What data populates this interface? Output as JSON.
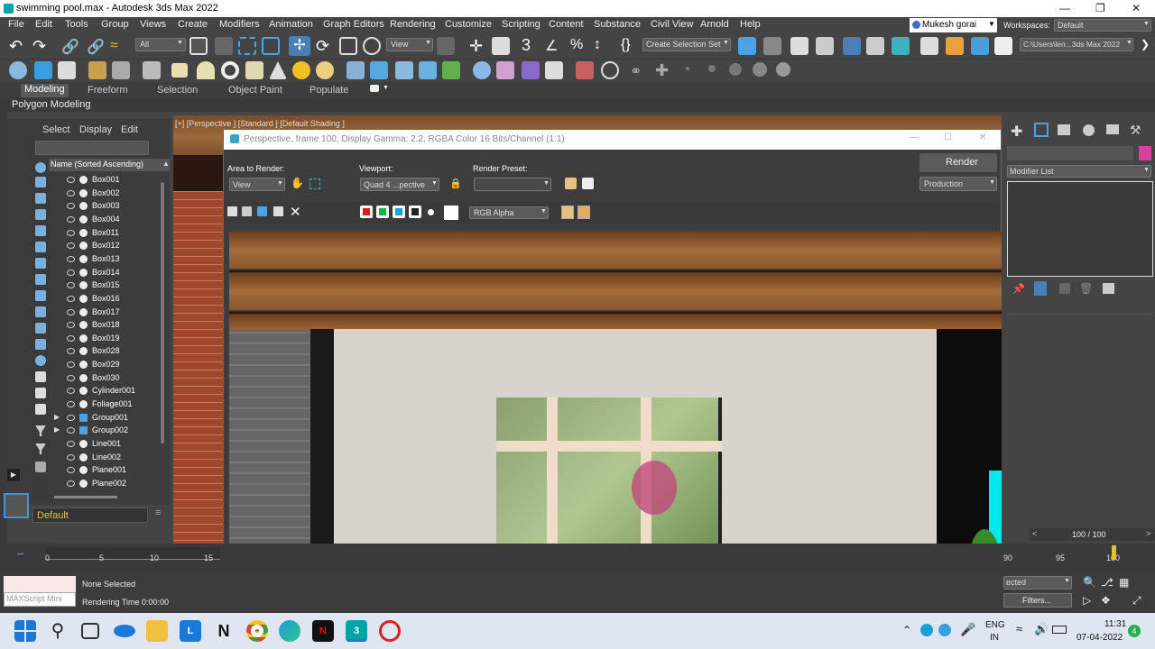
{
  "window": {
    "title": "swimming pool.max - Autodesk 3ds Max 2022",
    "user": "Mukesh gorai",
    "workspaces_label": "Workspaces:",
    "workspace": "Default"
  },
  "menu": [
    "File",
    "Edit",
    "Tools",
    "Group",
    "Views",
    "Create",
    "Modifiers",
    "Animation",
    "Graph Editors",
    "Rendering",
    "Customize",
    "Scripting",
    "Content",
    "Substance",
    "Civil View",
    "Arnold",
    "Help"
  ],
  "toolbar": {
    "selection_filter": "All",
    "view_dropdown": "View",
    "selection_set": "Create Selection Set",
    "path": "C:\\Users\\len...3ds Max 2022"
  },
  "ribbon": {
    "tabs": [
      "Modeling",
      "Freeform",
      "Selection",
      "Object Paint",
      "Populate"
    ],
    "active": "Modeling",
    "sub": "Polygon Modeling"
  },
  "scene_explorer": {
    "menu": [
      "Select",
      "Display",
      "Edit"
    ],
    "column_header": "Name (Sorted Ascending)",
    "items": [
      "Box001",
      "Box002",
      "Box003",
      "Box004",
      "Box011",
      "Box012",
      "Box013",
      "Box014",
      "Box015",
      "Box016",
      "Box017",
      "Box018",
      "Box019",
      "Box028",
      "Box029",
      "Box030",
      "Cylinder001",
      "Foliage001",
      "Group001",
      "Group002",
      "Line001",
      "Line002",
      "Plane001",
      "Plane002"
    ],
    "layer": "Default"
  },
  "viewport": {
    "label": "[+] [Perspective ] [Standard ] [Default Shading ]"
  },
  "render_window": {
    "title": "Perspective, frame 100, Display Gamma: 2.2, RGBA Color 16 Bits/Channel (1:1)",
    "area_label": "Area to Render:",
    "area_value": "View",
    "viewport_label": "Viewport:",
    "viewport_value": "Quad 4 ...pective",
    "preset_label": "Render Preset:",
    "preset_value": "",
    "render_button": "Render",
    "render_mode": "Production",
    "channel": "RGB Alpha"
  },
  "command_panel": {
    "modifier_list": "Modifier List",
    "frame_counter": "100 / 100"
  },
  "timeline": {
    "ticks": [
      "0",
      "5",
      "10",
      "15"
    ],
    "ticks_right": [
      "90",
      "95",
      "100"
    ]
  },
  "status": {
    "selection": "None Selected",
    "rendering_time": "Rendering Time  0:00:00",
    "maxscript": "MAXScript Mini",
    "selected_dropdown": "ected",
    "filters": "Filters..."
  },
  "taskbar": {
    "lang1": "ENG",
    "lang2": "IN",
    "time": "11:31",
    "date": "07-04-2022",
    "notifications": "4"
  },
  "colors": {
    "accent_blue": "#4a90d9",
    "brick": "#a0482e",
    "wood": "#7a4a28",
    "wall": "#d8d4cc"
  }
}
